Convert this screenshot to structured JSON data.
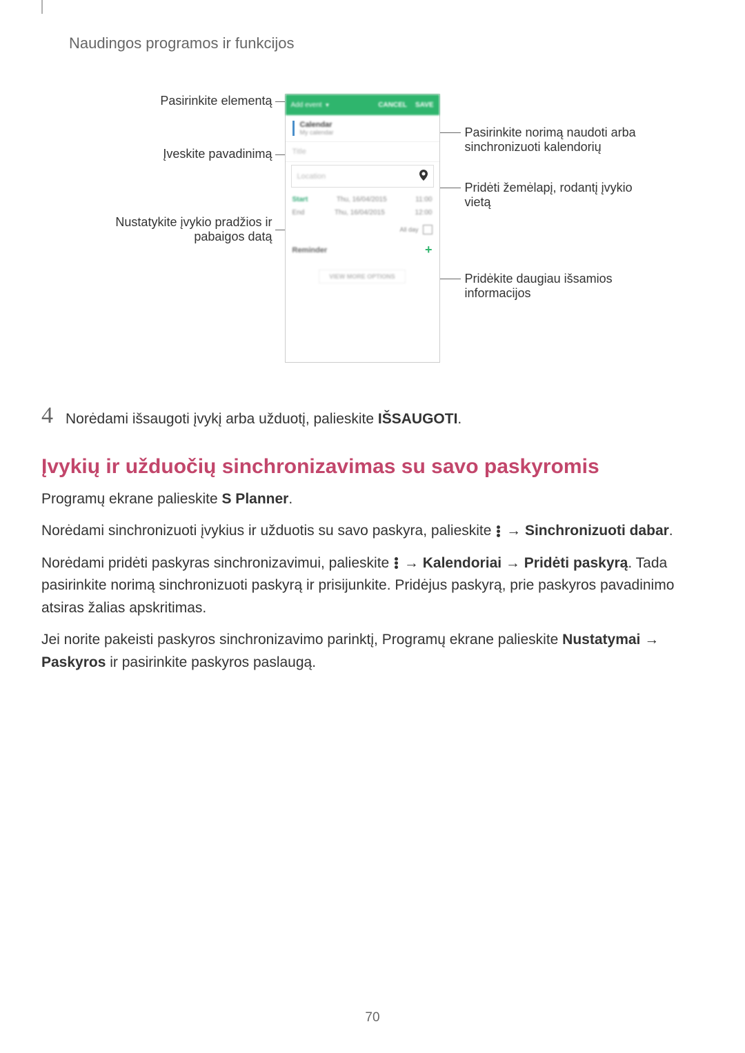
{
  "header": {
    "title": "Naudingos programos ir funkcijos"
  },
  "diagram": {
    "left": {
      "select_element": "Pasirinkite elementą",
      "enter_name": "Įveskite pavadinimą",
      "set_dates": "Nustatykite įvykio pradžios ir pabaigos datą"
    },
    "right": {
      "select_calendar": "Pasirinkite norimą naudoti arba sinchronizuoti kalendorių",
      "add_map": "Pridėti žemėlapį, rodantį įvykio vietą",
      "more_info": "Pridėkite daugiau išsamios informacijos"
    },
    "phone": {
      "add_event": "Add event",
      "cancel": "CANCEL",
      "save": "SAVE",
      "calendar_label": "Calendar",
      "calendar_sub": "My calendar",
      "title_placeholder": "Title",
      "location_placeholder": "Location",
      "start_label": "Start",
      "start_date": "Thu, 16/04/2015",
      "start_time": "11:00",
      "end_label": "End",
      "end_date": "Thu, 16/04/2015",
      "end_time": "12:00",
      "all_day": "All day",
      "reminder": "Reminder",
      "view_more": "VIEW MORE OPTIONS"
    }
  },
  "step4": {
    "number": "4",
    "text_prefix": "Norėdami išsaugoti įvykį arba užduotį, palieskite ",
    "text_bold": "IŠSAUGOTI",
    "text_suffix": "."
  },
  "section": {
    "title": "Įvykių ir užduočių sinchronizavimas su savo paskyromis"
  },
  "paragraphs": {
    "p1_prefix": "Programų ekrane palieskite ",
    "p1_bold": "S Planner",
    "p1_suffix": ".",
    "p2_prefix": "Norėdami sinchronizuoti įvykius ir užduotis su savo paskyra, palieskite ",
    "p2_arrow": " → ",
    "p2_bold": "Sinchronizuoti dabar",
    "p2_suffix": ".",
    "p3_prefix": "Norėdami pridėti paskyras sinchronizavimui, palieskite ",
    "p3_bold1": "Kalendoriai",
    "p3_bold2": "Pridėti paskyrą",
    "p3_rest": ". Tada pasirinkite norimą sinchronizuoti paskyrą ir prisijunkite. Pridėjus paskyrą, prie paskyros pavadinimo atsiras žalias apskritimas.",
    "p4_prefix": "Jei norite pakeisti paskyros sinchronizavimo parinktį, Programų ekrane palieskite ",
    "p4_bold1": "Nustatymai",
    "p4_arrow": " → ",
    "p4_bold2": "Paskyros",
    "p4_rest": " ir pasirinkite paskyros paslaugą."
  },
  "page_number": "70"
}
